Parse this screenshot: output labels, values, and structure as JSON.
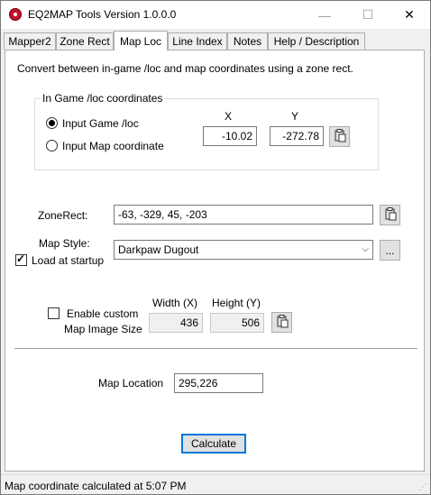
{
  "window": {
    "title": "EQ2MAP Tools Version 1.0.0.0",
    "controls": {
      "minimize": "—",
      "maximize": "☐",
      "close": "✕"
    }
  },
  "tabs": [
    {
      "label": "Mapper2",
      "active": false
    },
    {
      "label": "Zone Rect",
      "active": false
    },
    {
      "label": "Map Loc",
      "active": true
    },
    {
      "label": "Line Index",
      "active": false
    },
    {
      "label": "Notes",
      "active": false
    },
    {
      "label": "Help / Description",
      "active": false
    }
  ],
  "maploc": {
    "description": "Convert between in-game /loc and map coordinates using a zone rect.",
    "group_label": "In Game /loc coordinates",
    "radio_game_loc": "Input Game /loc",
    "radio_map_coord": "Input Map coordinate",
    "selected_mode": "game_loc",
    "x_label": "X",
    "y_label": "Y",
    "x_value": "-10.02",
    "y_value": "-272.78",
    "zonerect_label": "ZoneRect:",
    "zonerect_value": "-63, -329, 45, -203",
    "map_style_label": "Map Style:",
    "map_style_value": "Darkpaw Dugout",
    "browse_label": "...",
    "load_at_startup_label": "Load at startup",
    "load_at_startup_checked": true,
    "enable_custom_label_line1": "Enable custom",
    "enable_custom_label_line2": "Map Image Size",
    "enable_custom_checked": false,
    "width_label": "Width (X)",
    "height_label": "Height (Y)",
    "width_value": "436",
    "height_value": "506",
    "map_location_label": "Map Location",
    "map_location_value": "295,226",
    "calculate_label": "Calculate"
  },
  "status": {
    "text": "Map coordinate calculated at 5:07 PM"
  }
}
